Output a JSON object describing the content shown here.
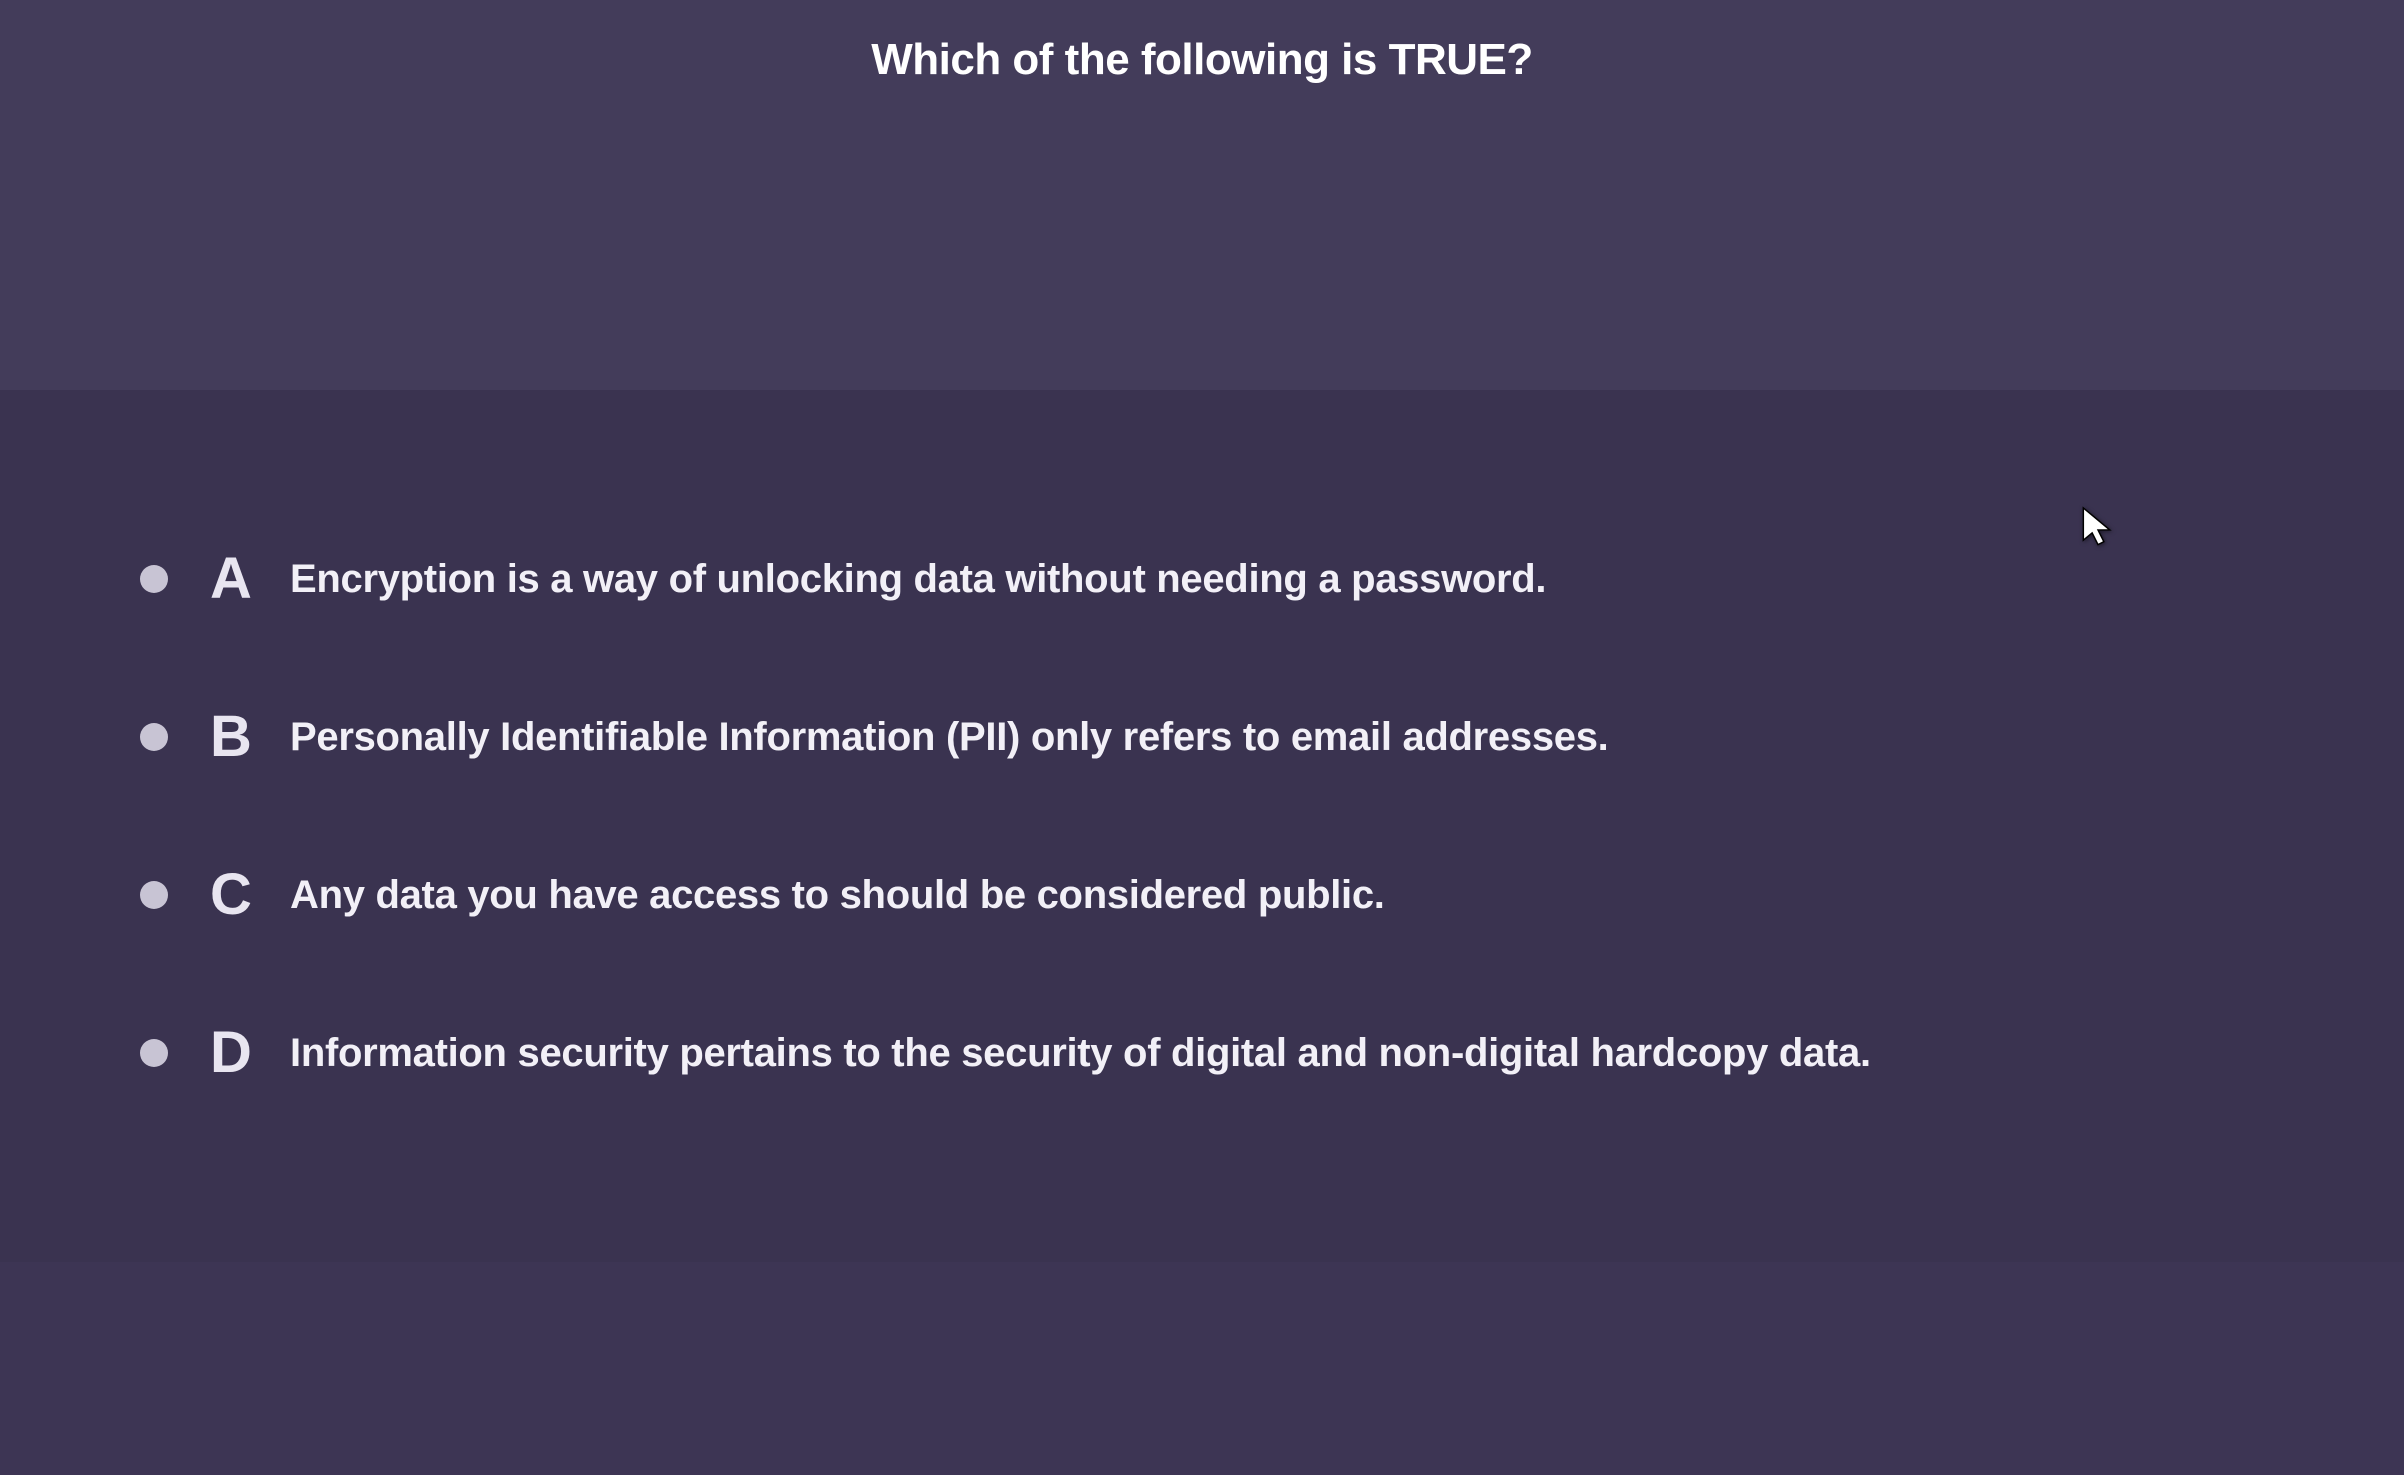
{
  "question": {
    "title": "Which of the following is TRUE?"
  },
  "options": [
    {
      "letter": "A",
      "text": "Encryption is a way of unlocking data without needing a password."
    },
    {
      "letter": "B",
      "text": "Personally Identifiable Information (PII) only refers to email addresses."
    },
    {
      "letter": "C",
      "text": "Any data you have access to should be considered public."
    },
    {
      "letter": "D",
      "text": "Information security pertains to the security of digital and non-digital hardcopy data."
    }
  ]
}
